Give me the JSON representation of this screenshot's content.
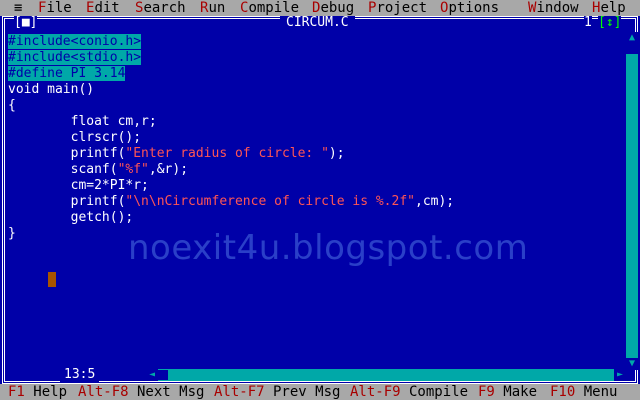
{
  "menu": {
    "system": "≡",
    "items": [
      {
        "hot": "F",
        "rest": "ile"
      },
      {
        "hot": "E",
        "rest": "dit"
      },
      {
        "hot": "S",
        "rest": "earch"
      },
      {
        "hot": "R",
        "rest": "un"
      },
      {
        "hot": "C",
        "rest": "ompile"
      },
      {
        "hot": "D",
        "rest": "ebug"
      },
      {
        "hot": "P",
        "rest": "roject"
      },
      {
        "hot": "O",
        "rest": "ptions"
      },
      {
        "hot": "W",
        "rest": "indow"
      },
      {
        "hot": "H",
        "rest": "elp"
      }
    ]
  },
  "window": {
    "close_button": "[■]",
    "title": "CIRCUM.C",
    "number": "1",
    "zoom_button": "[↕]"
  },
  "editor": {
    "lines": [
      "#include<conio.h>",
      "#include<stdio.h>",
      "#define PI 3.14",
      "void main()",
      "{",
      "        float cm,r;",
      "        clrscr();",
      "        printf(\"Enter radius of circle: \");",
      "        scanf(\"%f\",&r);",
      "        cm=2*PI*r;",
      "        printf(\"\\n\\nCircumference of circle is %.2f\",cm);",
      "        getch();",
      "}"
    ],
    "cursor_position": "13:5"
  },
  "watermark": "noexit4u.blogspot.com",
  "status_bar": [
    {
      "key": "F1",
      "label": " Help"
    },
    {
      "key": "Alt-F8",
      "label": " Next Msg"
    },
    {
      "key": "Alt-F7",
      "label": " Prev Msg"
    },
    {
      "key": "Alt-F9",
      "label": " Compile"
    },
    {
      "key": "F9",
      "label": " Make"
    },
    {
      "key": "F10",
      "label": " Menu"
    }
  ],
  "colors": {
    "editor_bg": "#0000A8",
    "menu_bg": "#A8A8A8",
    "hotkey": "#A80000",
    "selection": "#00A8A8",
    "string": "#FF5555"
  }
}
